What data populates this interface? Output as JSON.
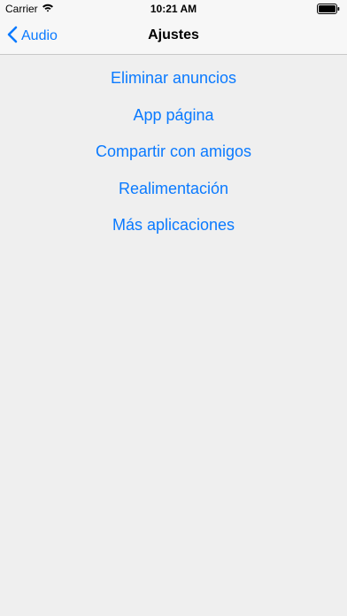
{
  "status_bar": {
    "carrier": "Carrier",
    "time": "10:21 AM"
  },
  "nav": {
    "back_label": "Audio",
    "title": "Ajustes"
  },
  "menu": {
    "items": [
      {
        "label": "Eliminar anuncios"
      },
      {
        "label": "App página"
      },
      {
        "label": "Compartir con amigos"
      },
      {
        "label": "Realimentación"
      },
      {
        "label": "Más aplicaciones"
      }
    ]
  },
  "colors": {
    "accent": "#0a7aff",
    "background": "#efefef",
    "bar_background": "#f7f7f7"
  }
}
